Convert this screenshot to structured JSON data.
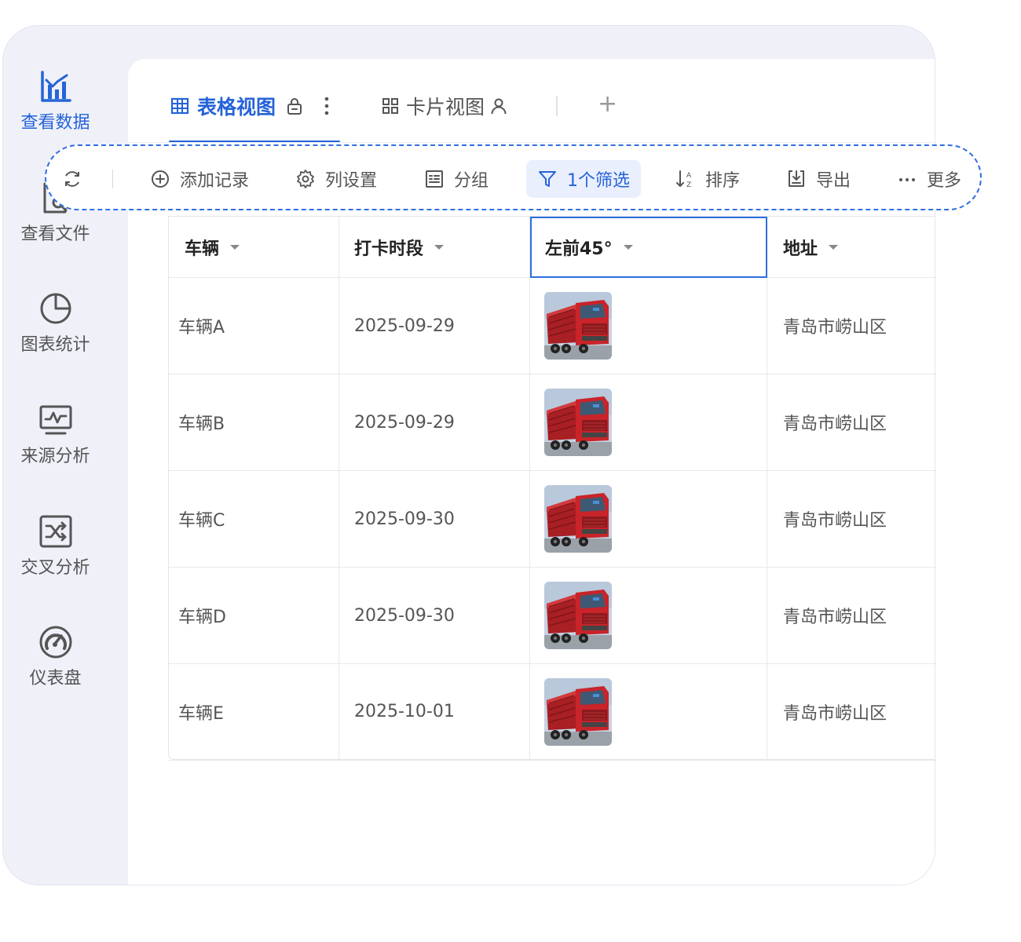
{
  "sidebar": {
    "items": [
      {
        "label": "查看数据",
        "icon": "bar-chart-icon",
        "active": true
      },
      {
        "label": "查看文件",
        "icon": "file-search-icon",
        "active": false
      },
      {
        "label": "图表统计",
        "icon": "pie-chart-icon",
        "active": false
      },
      {
        "label": "来源分析",
        "icon": "monitor-pulse-icon",
        "active": false
      },
      {
        "label": "交叉分析",
        "icon": "shuffle-icon",
        "active": false
      },
      {
        "label": "仪表盘",
        "icon": "gauge-icon",
        "active": false
      }
    ]
  },
  "tabs": {
    "items": [
      {
        "label": "表格视图",
        "icon": "table-grid-icon",
        "active": true
      },
      {
        "label": "卡片视图",
        "icon": "card-grid-icon",
        "active": false
      }
    ],
    "add_label": "+"
  },
  "toolbar": {
    "add_record": "添加记录",
    "column_settings": "列设置",
    "group": "分组",
    "filter": "1个筛选",
    "sort": "排序",
    "export": "导出",
    "more": "更多"
  },
  "table": {
    "columns": [
      "车辆",
      "打卡时段",
      "左前45°",
      "地址"
    ],
    "rows": [
      {
        "vehicle": "车辆A",
        "date": "2025-09-29",
        "image": "red-truck-photo",
        "address": "青岛市崂山区"
      },
      {
        "vehicle": "车辆B",
        "date": "2025-09-29",
        "image": "red-truck-photo",
        "address": "青岛市崂山区"
      },
      {
        "vehicle": "车辆C",
        "date": "2025-09-30",
        "image": "red-truck-photo",
        "address": "青岛市崂山区"
      },
      {
        "vehicle": "车辆D",
        "date": "2025-09-30",
        "image": "red-truck-photo",
        "address": "青岛市崂山区"
      },
      {
        "vehicle": "车辆E",
        "date": "2025-10-01",
        "image": "red-truck-photo",
        "address": "青岛市崂山区"
      }
    ]
  },
  "colors": {
    "accent": "#2563d8",
    "sidebar_bg": "#eff0f8",
    "filter_bg": "#e9effd",
    "truck_red": "#c8242a"
  }
}
